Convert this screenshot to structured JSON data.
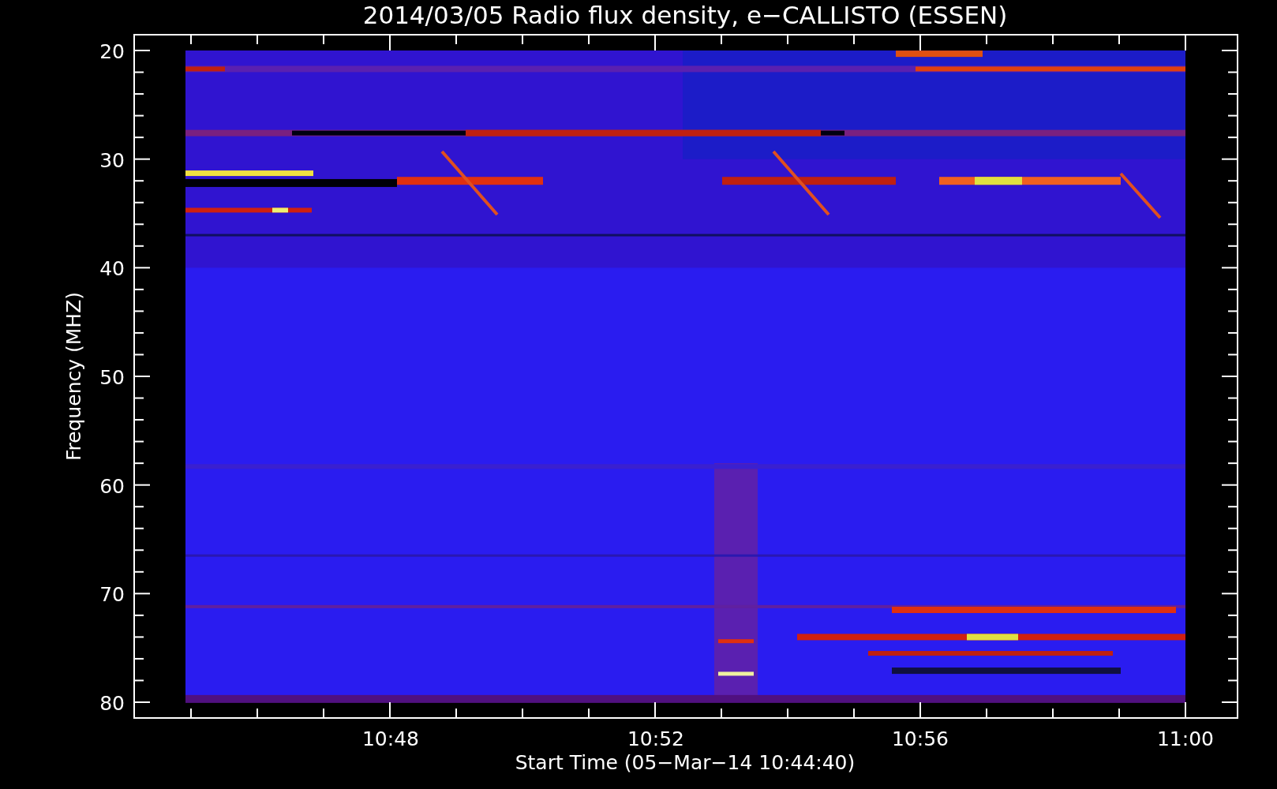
{
  "title": "2014/03/05  Radio flux density, e−CALLISTO (ESSEN)",
  "y_axis": {
    "label": "Frequency (MHZ)",
    "ticks": [
      "20",
      "30",
      "40",
      "50",
      "60",
      "70",
      "80"
    ]
  },
  "x_axis": {
    "label": "Start Time (05−Mar−14 10:44:40)",
    "ticks": [
      "10:48",
      "10:52",
      "10:56",
      "11:00"
    ]
  }
}
